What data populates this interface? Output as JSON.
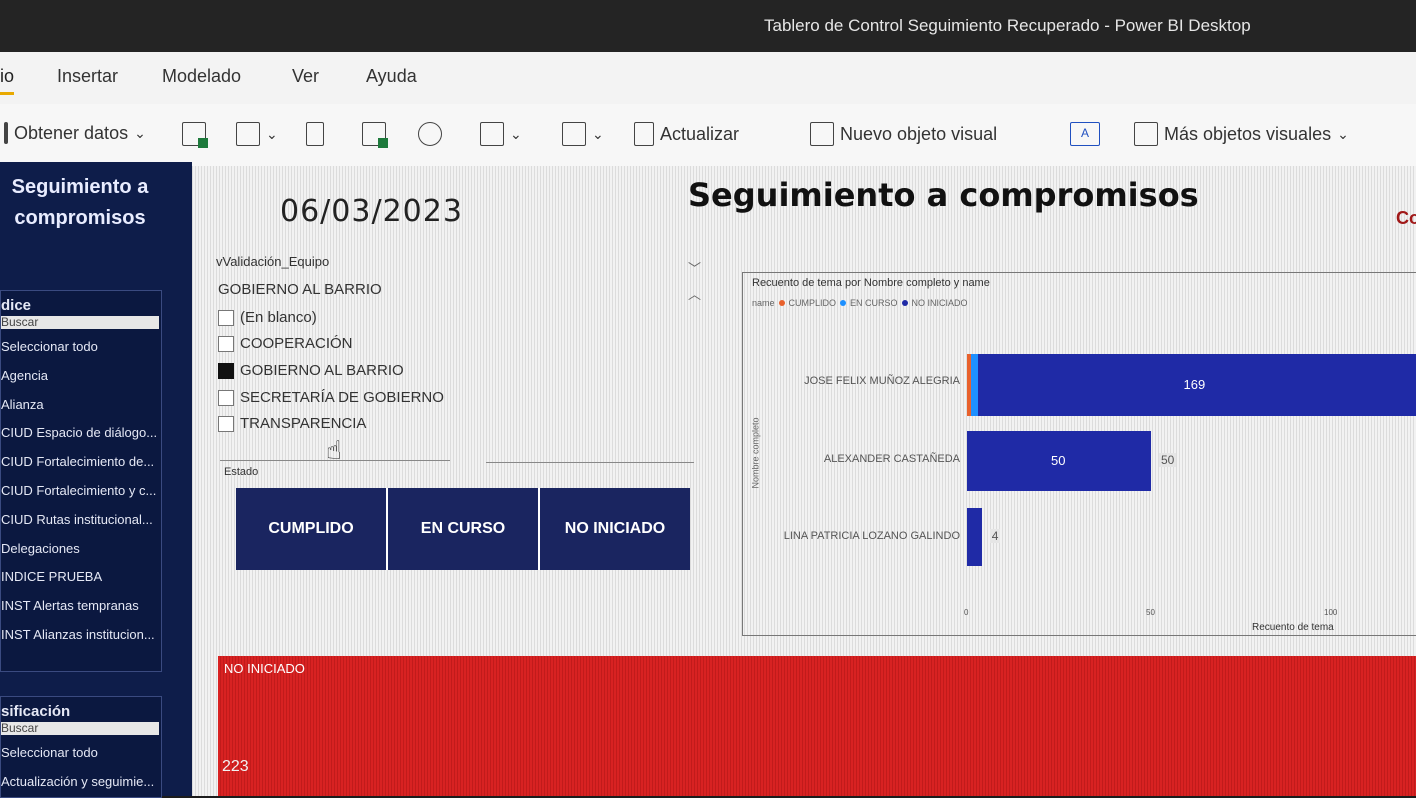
{
  "window": {
    "title": "Tablero de Control Seguimiento Recuperado - Power BI Desktop"
  },
  "ribbon": {
    "tabs": [
      "io",
      "Insertar",
      "Modelado",
      "Ver",
      "Ayuda"
    ],
    "active_tab": "io",
    "toolbar": {
      "get_data": "Obtener datos",
      "refresh": "Actualizar",
      "new_visual": "Nuevo objeto visual",
      "more_visuals": "Más objetos visuales"
    }
  },
  "sidebar": {
    "title": "Seguimiento a compromisos",
    "indice": {
      "header": "dice",
      "search": "Buscar",
      "items": [
        "Seleccionar todo",
        "Agencia",
        "Alianza",
        "CIUD Espacio de diálogo...",
        "CIUD Fortalecimiento de...",
        "CIUD Fortalecimiento y c...",
        "CIUD Rutas institucional...",
        "Delegaciones",
        "INDICE PRUEBA",
        "INST Alertas tempranas",
        "INST Alianzas institucion..."
      ]
    },
    "clasificacion": {
      "header": "sificación",
      "search": "Buscar",
      "items": [
        "Seleccionar todo",
        "Actualización y seguimie..."
      ]
    }
  },
  "report": {
    "date": "06/03/2023",
    "title": "Seguimiento a compromisos",
    "edge_logo": "Co",
    "team_filter": {
      "label": "vValidación_Equipo",
      "selected": "GOBIERNO AL BARRIO",
      "options": [
        {
          "label": "(En blanco)",
          "checked": false
        },
        {
          "label": "COOPERACIÓN",
          "checked": false
        },
        {
          "label": "GOBIERNO AL BARRIO",
          "checked": true
        },
        {
          "label": "SECRETARÍA DE GOBIERNO",
          "checked": false
        },
        {
          "label": "TRANSPARENCIA",
          "checked": false
        }
      ]
    },
    "estado": {
      "label": "Estado",
      "buttons": [
        "CUMPLIDO",
        "EN CURSO",
        "NO INICIADO"
      ]
    },
    "card": {
      "title": "NO INICIADO",
      "value": "223"
    }
  },
  "chart_data": {
    "type": "bar",
    "orientation": "horizontal",
    "stacked": true,
    "title": "Recuento de tema por Nombre completo y name",
    "legend_title": "name",
    "legend": [
      "CUMPLIDO",
      "EN CURSO",
      "NO INICIADO"
    ],
    "colors": {
      "CUMPLIDO": "#e8612c",
      "EN CURSO": "#1e90ff",
      "NO INICIADO": "#1f2aa6"
    },
    "categories": [
      "JOSE FELIX MUÑOZ ALEGRIA",
      "ALEXANDER CASTAÑEDA",
      "LINA PATRICIA LOZANO GALINDO"
    ],
    "series": [
      {
        "name": "CUMPLIDO",
        "values": [
          1,
          0,
          0
        ]
      },
      {
        "name": "EN CURSO",
        "values": [
          2,
          0,
          0
        ]
      },
      {
        "name": "NO INICIADO",
        "values": [
          169,
          50,
          4
        ]
      }
    ],
    "data_labels": [
      "169",
      "50",
      "4"
    ],
    "outside_labels": [
      "",
      "50",
      "4"
    ],
    "x_ticks": [
      "0",
      "50",
      "100"
    ],
    "xlabel": "Recuento de tema",
    "ylabel": "Nombre completo",
    "xlim": [
      0,
      100
    ]
  }
}
